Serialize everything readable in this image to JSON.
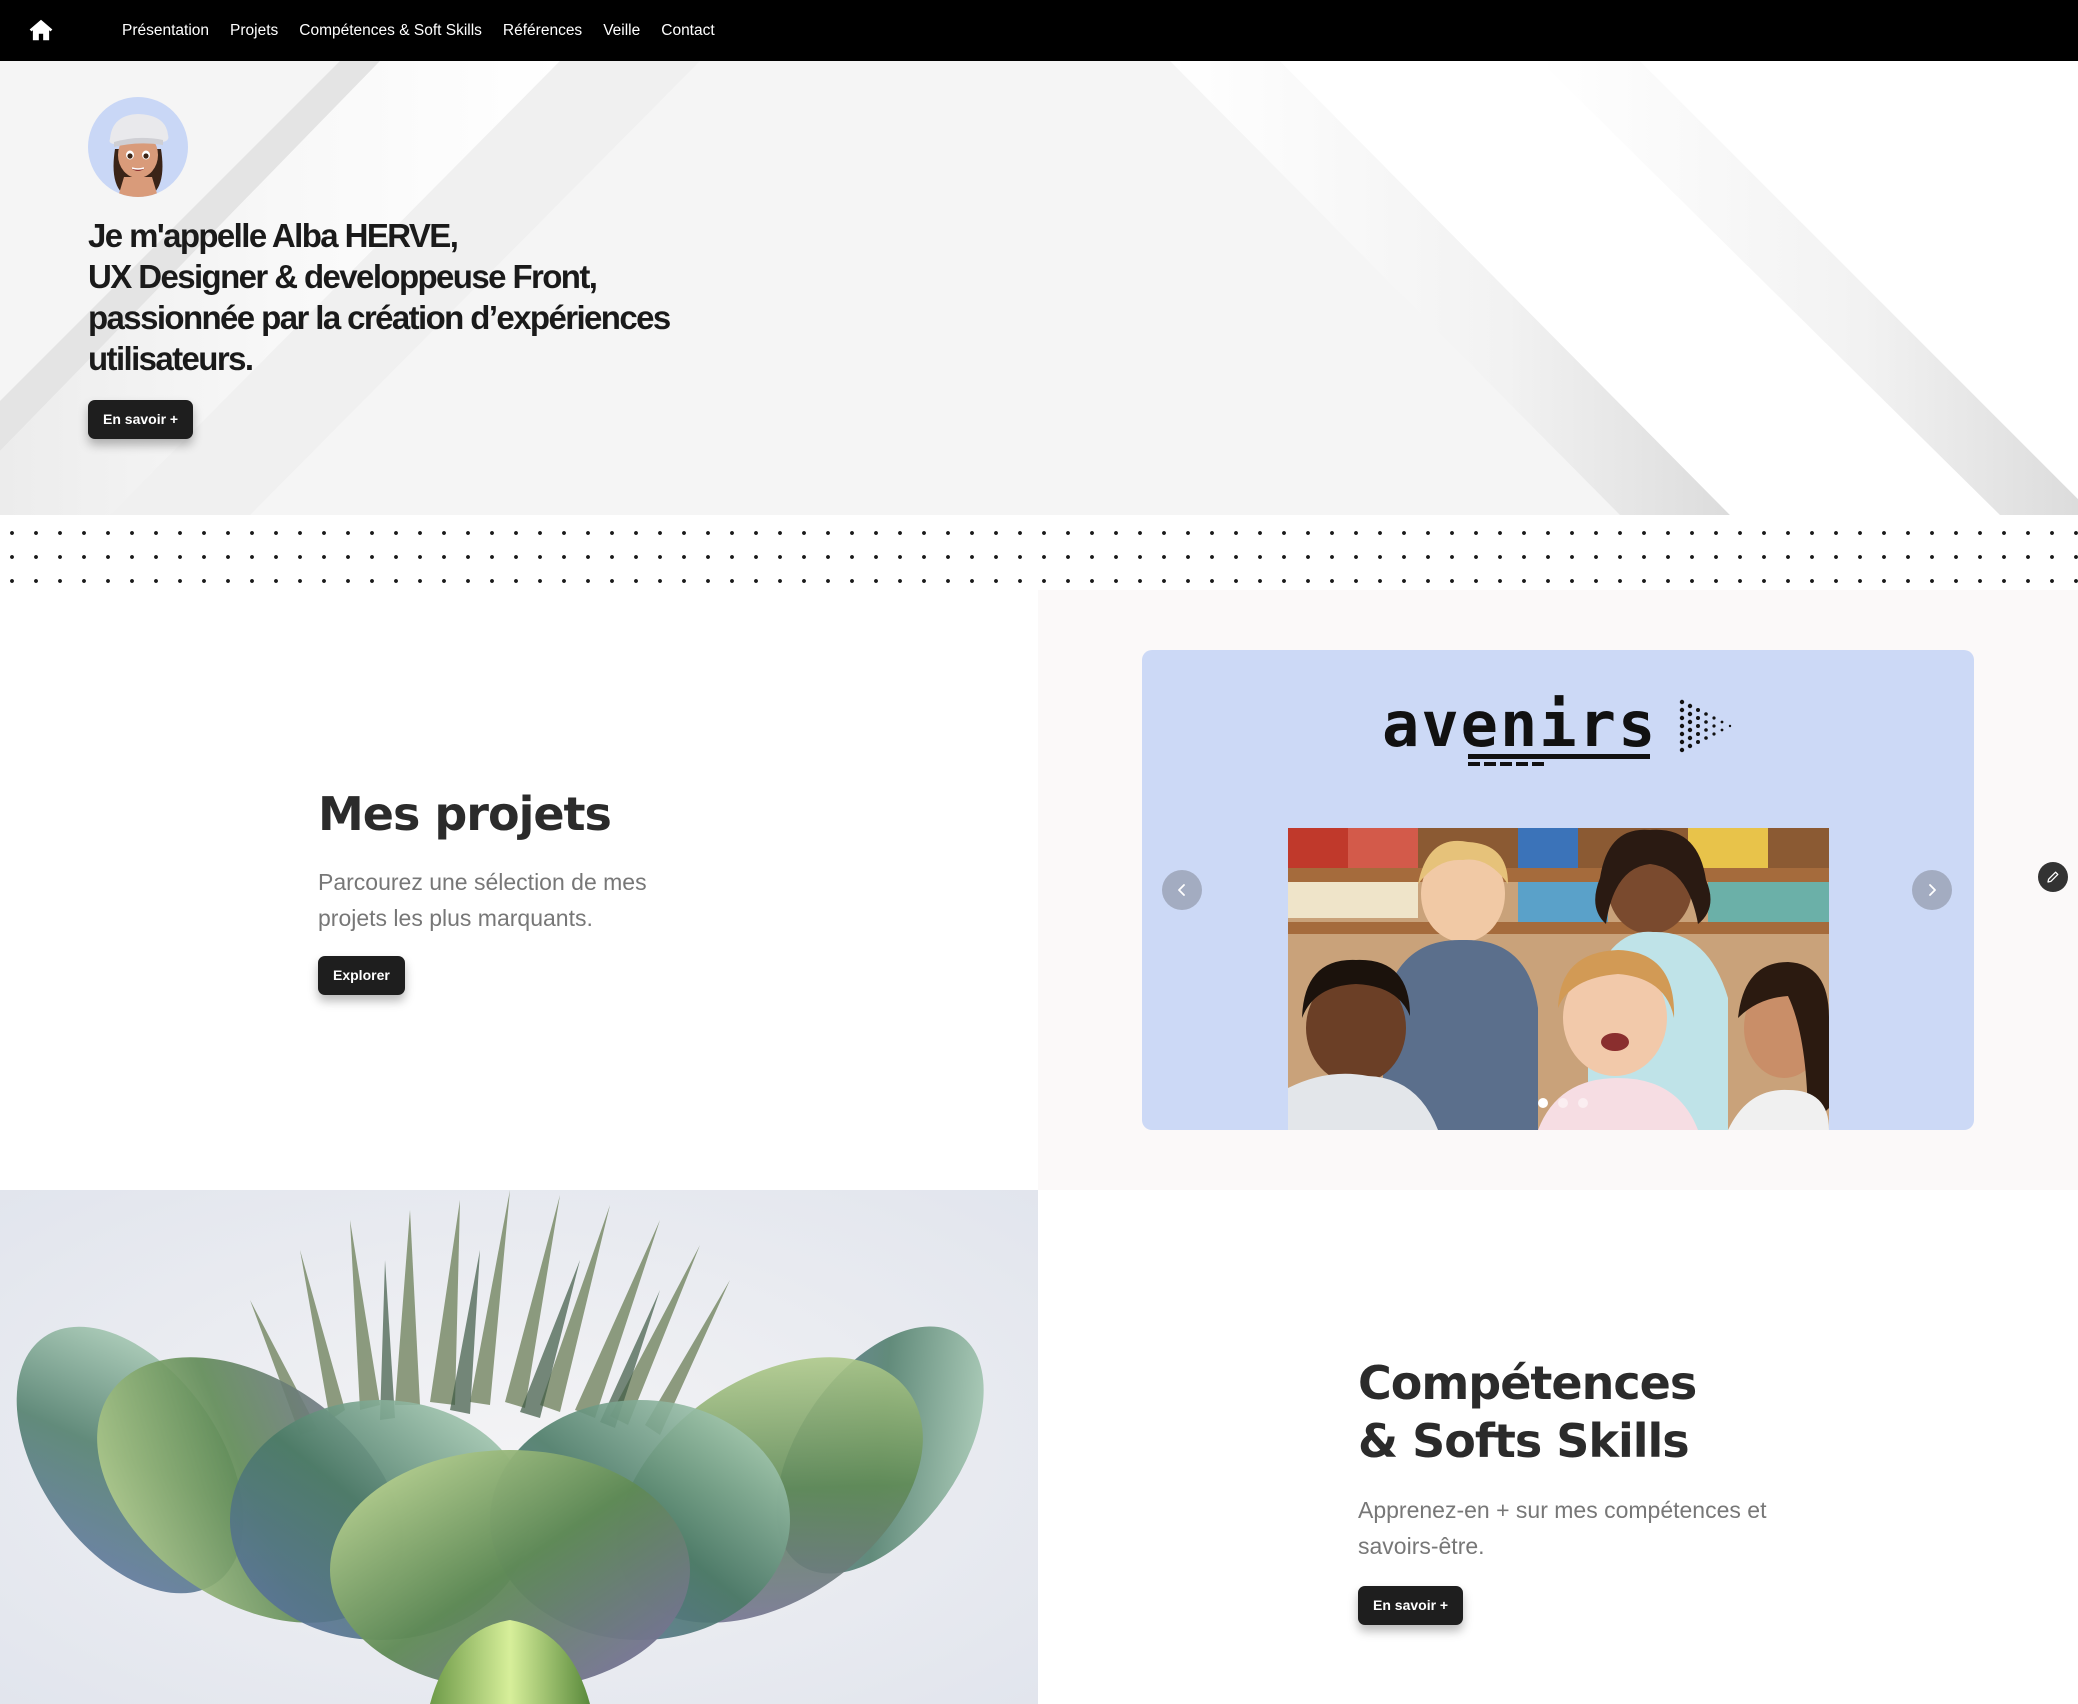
{
  "nav": {
    "home_icon": "home-icon",
    "items": [
      {
        "label": "Présentation"
      },
      {
        "label": "Projets"
      },
      {
        "label": "Compétences & Soft Skills"
      },
      {
        "label": "Références"
      },
      {
        "label": "Veille"
      },
      {
        "label": "Contact"
      }
    ]
  },
  "hero": {
    "avatar_icon": "memoji-avatar",
    "title_lines": [
      "Je m'appelle Alba HERVE,",
      "UX Designer & developpeuse Front,",
      "passionnée par la création d’expériences",
      "utilisateurs."
    ],
    "button_label": "En savoir +"
  },
  "projects": {
    "title": "Mes projets",
    "subtitle": "Parcourez une sélection de mes projets les plus marquants.",
    "button_label": "Explorer",
    "carousel": {
      "logo_text": "avenirs",
      "slide_count": 3,
      "active_slide": 0,
      "background": "#ccd9f6"
    }
  },
  "skills": {
    "title_lines": [
      "Compétences",
      "& Softs Skills"
    ],
    "subtitle": "Apprenez-en + sur mes compétences et savoirs-être.",
    "button_label": "En savoir +"
  },
  "colors": {
    "nav_bg": "#000000",
    "button_bg": "#1e1e1e",
    "text_dark": "#2b2b2b",
    "text_muted": "#777777"
  }
}
